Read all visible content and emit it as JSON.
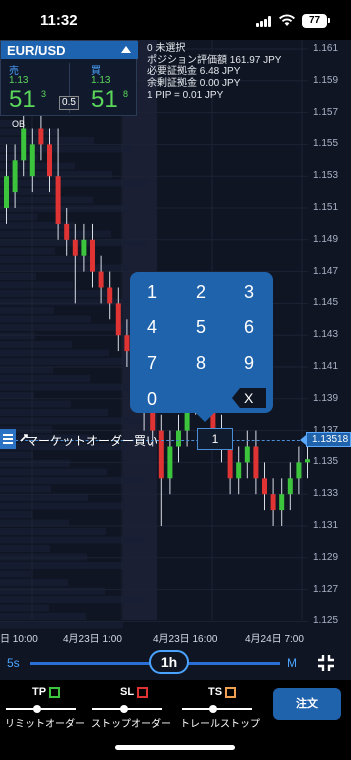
{
  "status_bar": {
    "time": "11:32",
    "battery": "77"
  },
  "instrument": {
    "symbol": "EUR/USD",
    "sell": {
      "label": "売",
      "small": "1.13",
      "big": "51",
      "sup": "3"
    },
    "buy": {
      "label": "買",
      "small": "1.13",
      "big": "51",
      "sup": "8"
    },
    "spread": "0.5"
  },
  "position_info": {
    "line1": "0 未選択",
    "line2": "ポジション評価額 161.97 JPY",
    "line3": "必要証拠金 6.48 JPY",
    "line4": "余剰証拠金 0.00 JPY",
    "line5": "1 PIP = 0.01 JPY"
  },
  "ob_label": "OB",
  "y_axis": [
    "1.161",
    "1.159",
    "1.157",
    "1.155",
    "1.153",
    "1.151",
    "1.149",
    "1.147",
    "1.145",
    "1.143",
    "1.141",
    "1.139",
    "1.137",
    "1.135",
    "1.133",
    "1.131",
    "1.129",
    "1.127",
    "1.125"
  ],
  "x_axis": [
    "日 10:00",
    "4月23日 1:00",
    "4月23日 16:00",
    "4月24日 7:00"
  ],
  "keypad": {
    "keys": [
      "1",
      "2",
      "3",
      "4",
      "5",
      "6",
      "7",
      "8",
      "9",
      "0"
    ],
    "delete": "X"
  },
  "order_line": {
    "label": "マーケットオーダー買い",
    "quantity": "1",
    "current_price": "1.13518"
  },
  "timeframe": {
    "min": "5s",
    "max": "M",
    "selected": "1h"
  },
  "bottom": {
    "tp": {
      "tag": "TP",
      "label": "リミットオーダー",
      "color": "#3cc43c"
    },
    "sl": {
      "tag": "SL",
      "label": "ストップオーダー",
      "color": "#e03434"
    },
    "ts": {
      "tag": "TS",
      "label": "トレールストップ",
      "color": "#f0a050"
    },
    "order_button": "注文"
  },
  "colors": {
    "accent": "#1f63ad",
    "up": "#3cc43c",
    "down": "#e03434",
    "background": "#0f1522"
  }
}
